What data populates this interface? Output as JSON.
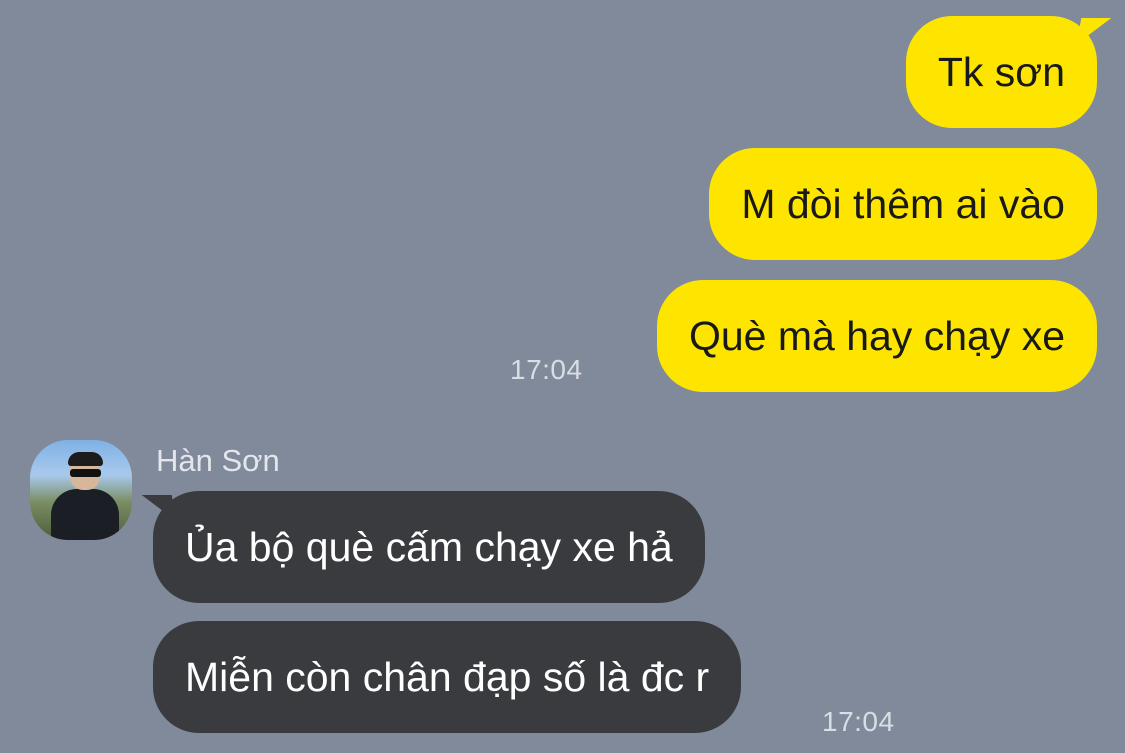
{
  "sender": {
    "name": "Hàn Sơn"
  },
  "outgoing": [
    {
      "text": "Tk sơn"
    },
    {
      "text": "M đòi thêm ai vào"
    },
    {
      "text": "Què mà hay chạy xe"
    }
  ],
  "outgoing_time": "17:04",
  "incoming": [
    {
      "text": "Ủa bộ què cấm chạy xe hả"
    },
    {
      "text": "Miễn còn chân đạp số là đc r"
    }
  ],
  "incoming_time": "17:04",
  "colors": {
    "background": "#808a9b",
    "outgoing_bubble": "#fee500",
    "incoming_bubble": "#3a3b3f"
  }
}
